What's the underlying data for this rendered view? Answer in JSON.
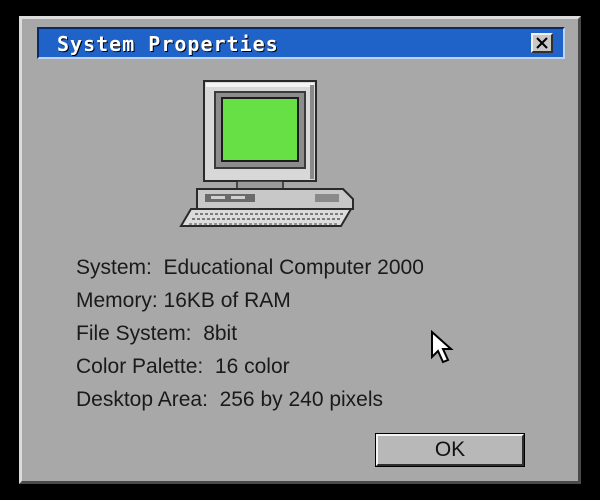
{
  "dialog": {
    "title": "System Properties",
    "close_icon": "close-x-icon",
    "computer_icon": "computer-icon",
    "screen_color": "#66e044",
    "titlebar_color": "#1f62c8",
    "info": [
      {
        "label": "System:",
        "value": "Educational Computer 2000"
      },
      {
        "label": "Memory:",
        "value": "16KB of RAM"
      },
      {
        "label": "File System:",
        "value": "8bit"
      },
      {
        "label": "Color Palette:",
        "value": "16 color"
      },
      {
        "label": "Desktop Area:",
        "value": "256 by 240 pixels"
      }
    ],
    "ok_label": "OK"
  },
  "pointer": {
    "icon": "mouse-pointer-icon"
  }
}
